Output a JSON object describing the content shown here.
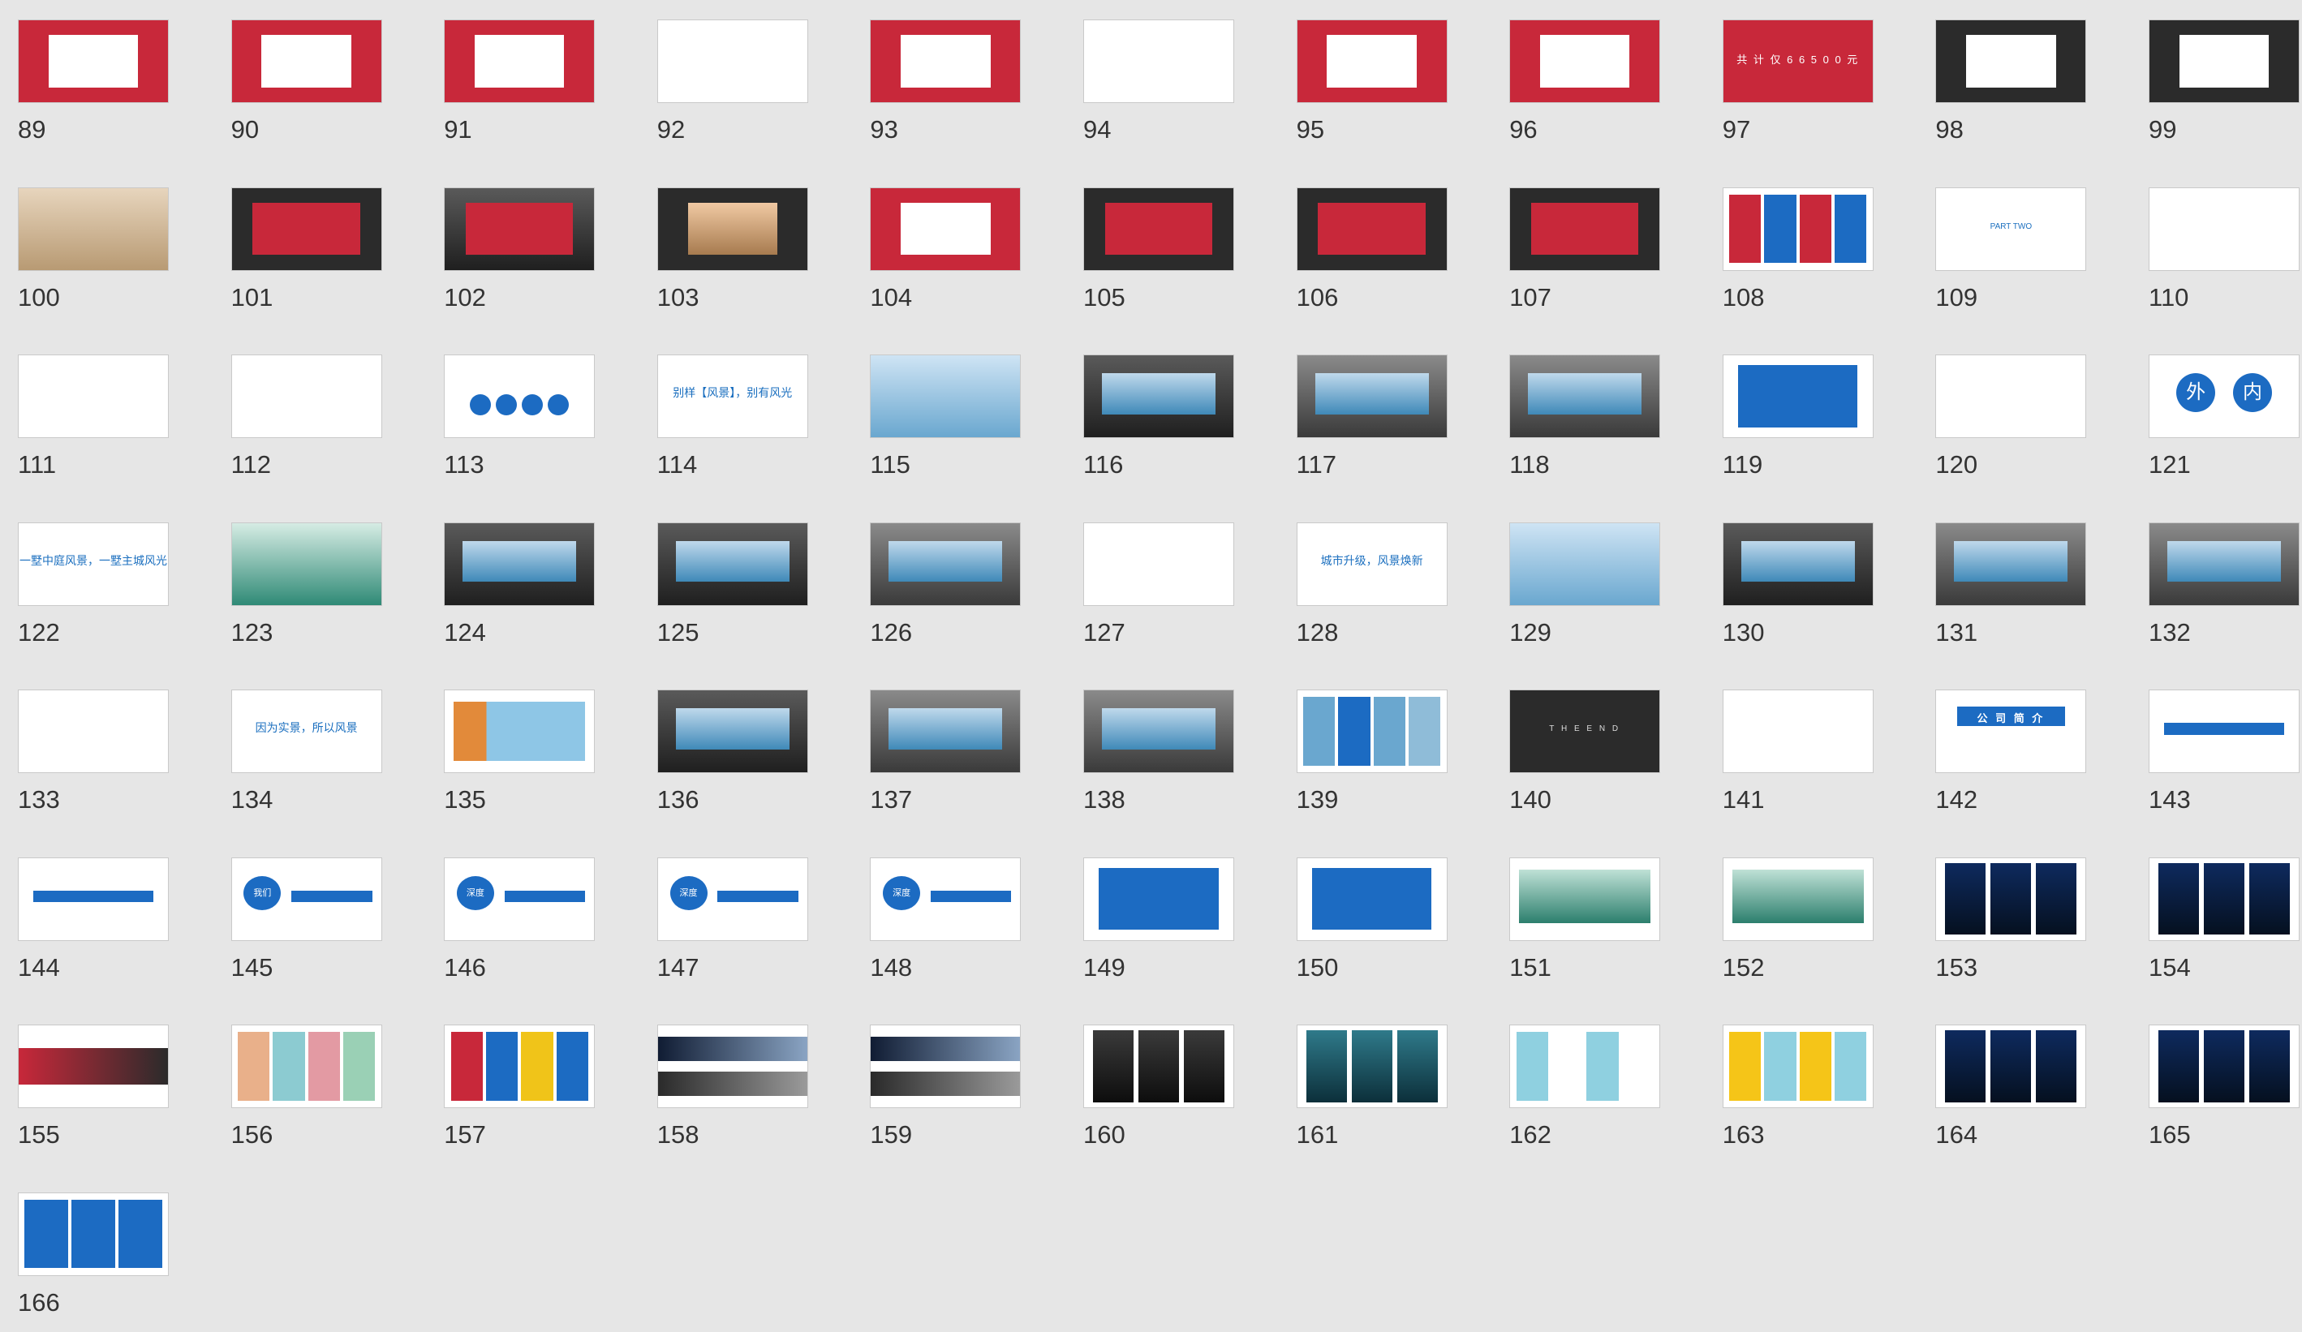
{
  "thumbnails": [
    {
      "n": "89",
      "style": "red",
      "text": ""
    },
    {
      "n": "90",
      "style": "red",
      "text": ""
    },
    {
      "n": "91",
      "style": "red",
      "text": ""
    },
    {
      "n": "92",
      "style": "white",
      "text": ""
    },
    {
      "n": "93",
      "style": "red",
      "text": ""
    },
    {
      "n": "94",
      "style": "white",
      "text": ""
    },
    {
      "n": "95",
      "style": "red",
      "text": ""
    },
    {
      "n": "96",
      "style": "red",
      "text": ""
    },
    {
      "n": "97",
      "style": "red",
      "text": "共 计 仅 6 6 5 0 0 元"
    },
    {
      "n": "98",
      "style": "dark",
      "text": ""
    },
    {
      "n": "99",
      "style": "dark",
      "text": ""
    },
    {
      "n": "100",
      "style": "photo",
      "text": ""
    },
    {
      "n": "101",
      "style": "dark",
      "text": ""
    },
    {
      "n": "102",
      "style": "bill",
      "text": ""
    },
    {
      "n": "103",
      "style": "dark",
      "text": ""
    },
    {
      "n": "104",
      "style": "red",
      "text": ""
    },
    {
      "n": "105",
      "style": "dark",
      "text": ""
    },
    {
      "n": "106",
      "style": "dark",
      "text": ""
    },
    {
      "n": "107",
      "style": "dark",
      "text": ""
    },
    {
      "n": "108",
      "style": "white",
      "text": ""
    },
    {
      "n": "109",
      "style": "white",
      "text": "PART TWO"
    },
    {
      "n": "110",
      "style": "white",
      "text": ""
    },
    {
      "n": "111",
      "style": "white",
      "text": ""
    },
    {
      "n": "112",
      "style": "white",
      "text": ""
    },
    {
      "n": "113",
      "style": "white",
      "text": ""
    },
    {
      "n": "114",
      "style": "white",
      "text": "别样【风景】，别有风光"
    },
    {
      "n": "115",
      "style": "white",
      "text": ""
    },
    {
      "n": "116",
      "style": "bill",
      "text": ""
    },
    {
      "n": "117",
      "style": "station",
      "text": ""
    },
    {
      "n": "118",
      "style": "station",
      "text": ""
    },
    {
      "n": "119",
      "style": "white",
      "text": ""
    },
    {
      "n": "120",
      "style": "white",
      "text": ""
    },
    {
      "n": "121",
      "style": "white",
      "text": ""
    },
    {
      "n": "122",
      "style": "white",
      "text": "一墅中庭风景，一墅主城风光"
    },
    {
      "n": "123",
      "style": "white",
      "text": ""
    },
    {
      "n": "124",
      "style": "bill",
      "text": ""
    },
    {
      "n": "125",
      "style": "bill",
      "text": ""
    },
    {
      "n": "126",
      "style": "station",
      "text": ""
    },
    {
      "n": "127",
      "style": "white",
      "text": ""
    },
    {
      "n": "128",
      "style": "white",
      "text": "城市升级，风景焕新"
    },
    {
      "n": "129",
      "style": "white",
      "text": ""
    },
    {
      "n": "130",
      "style": "bill",
      "text": ""
    },
    {
      "n": "131",
      "style": "station",
      "text": ""
    },
    {
      "n": "132",
      "style": "station",
      "text": ""
    },
    {
      "n": "133",
      "style": "white",
      "text": ""
    },
    {
      "n": "134",
      "style": "white",
      "text": "因为实景，所以风景"
    },
    {
      "n": "135",
      "style": "white",
      "text": ""
    },
    {
      "n": "136",
      "style": "bill",
      "text": ""
    },
    {
      "n": "137",
      "style": "station",
      "text": ""
    },
    {
      "n": "138",
      "style": "station",
      "text": ""
    },
    {
      "n": "139",
      "style": "white",
      "text": ""
    },
    {
      "n": "140",
      "style": "dark",
      "text": "T H E   E N D"
    },
    {
      "n": "141",
      "style": "white",
      "text": ""
    },
    {
      "n": "142",
      "style": "white",
      "text": "公 司 简 介"
    },
    {
      "n": "143",
      "style": "white",
      "text": ""
    },
    {
      "n": "144",
      "style": "white",
      "text": ""
    },
    {
      "n": "145",
      "style": "white",
      "text": "我们"
    },
    {
      "n": "146",
      "style": "white",
      "text": "深度"
    },
    {
      "n": "147",
      "style": "white",
      "text": "深度"
    },
    {
      "n": "148",
      "style": "white",
      "text": "深度"
    },
    {
      "n": "149",
      "style": "white",
      "text": ""
    },
    {
      "n": "150",
      "style": "white",
      "text": ""
    },
    {
      "n": "151",
      "style": "white",
      "text": ""
    },
    {
      "n": "152",
      "style": "white",
      "text": ""
    },
    {
      "n": "153",
      "style": "white",
      "text": ""
    },
    {
      "n": "154",
      "style": "white",
      "text": ""
    },
    {
      "n": "155",
      "style": "white",
      "text": ""
    },
    {
      "n": "156",
      "style": "white",
      "text": ""
    },
    {
      "n": "157",
      "style": "white",
      "text": ""
    },
    {
      "n": "158",
      "style": "white",
      "text": ""
    },
    {
      "n": "159",
      "style": "white",
      "text": ""
    },
    {
      "n": "160",
      "style": "white",
      "text": ""
    },
    {
      "n": "161",
      "style": "white",
      "text": ""
    },
    {
      "n": "162",
      "style": "white",
      "text": ""
    },
    {
      "n": "163",
      "style": "white",
      "text": ""
    },
    {
      "n": "164",
      "style": "white",
      "text": ""
    },
    {
      "n": "165",
      "style": "white",
      "text": ""
    },
    {
      "n": "166",
      "style": "white",
      "text": ""
    }
  ],
  "circle_labels": {
    "out": "外",
    "in": "内"
  },
  "colors": {
    "background": "#e6e6e6",
    "brand_red": "#c8283a",
    "brand_blue": "#1c6bc2",
    "dark_slide": "#2b2b2b",
    "label_text": "#333333"
  }
}
